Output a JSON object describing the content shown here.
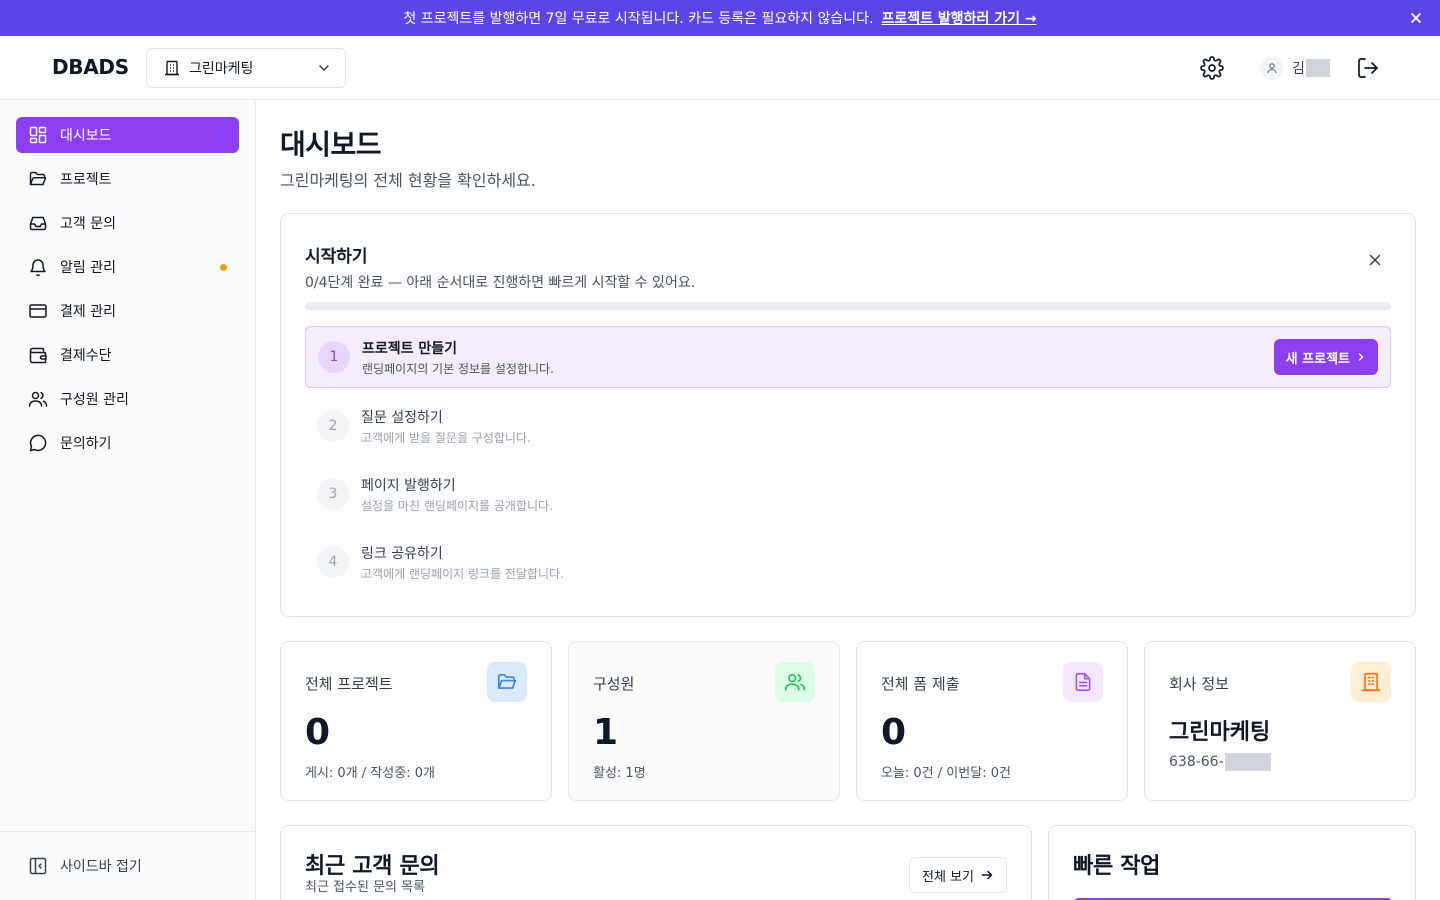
{
  "banner": {
    "text": "첫 프로젝트를 발행하면 7일 무료로 시작됩니다. 카드 등록은 필요하지 않습니다.",
    "link": "프로젝트 발행하러 가기 →",
    "bg_color": "#5b45e8"
  },
  "header": {
    "logo": "DBADS",
    "company_select": "그린마케팅",
    "user_name": "김"
  },
  "sidebar": {
    "items": [
      {
        "label": "대시보드",
        "icon": "dashboard-icon"
      },
      {
        "label": "프로젝트",
        "icon": "folder-icon"
      },
      {
        "label": "고객 문의",
        "icon": "inbox-icon"
      },
      {
        "label": "알림 관리",
        "icon": "bell-icon"
      },
      {
        "label": "결제 관리",
        "icon": "credit-card-icon"
      },
      {
        "label": "결제수단",
        "icon": "wallet-icon"
      },
      {
        "label": "구성원 관리",
        "icon": "users-icon"
      },
      {
        "label": "문의하기",
        "icon": "message-icon"
      }
    ],
    "collapse_label": "사이드바 접기",
    "accent_color": "#8b3ff0",
    "notification_dot_color": "#f59e0b"
  },
  "page": {
    "title": "대시보드",
    "subtitle": "그린마케팅의 전체 현황을 확인하세요."
  },
  "getting_started": {
    "title": "시작하기",
    "description": "0/4단계 완료 — 아래 순서대로 진행하면 빠르게 시작할 수 있어요.",
    "progress": 0,
    "steps": [
      {
        "num": "1",
        "title": "프로젝트 만들기",
        "desc": "랜딩페이지의 기본 정보를 설정합니다.",
        "button": "새 프로젝트"
      },
      {
        "num": "2",
        "title": "질문 설정하기",
        "desc": "고객에게 받을 질문을 구성합니다."
      },
      {
        "num": "3",
        "title": "페이지 발행하기",
        "desc": "설정을 마친 랜딩페이지를 공개합니다."
      },
      {
        "num": "4",
        "title": "링크 공유하기",
        "desc": "고객에게 랜딩페이지 링크를 전달합니다."
      }
    ]
  },
  "stats": {
    "projects": {
      "label": "전체 프로젝트",
      "value": "0",
      "sub": "게시: 0개 / 작성중: 0개",
      "icon": "folder-open-icon",
      "icon_color": "#3b82f6",
      "icon_bg": "#dbeafe"
    },
    "members": {
      "label": "구성원",
      "value": "1",
      "sub": "활성: 1명",
      "icon": "users-icon",
      "icon_color": "#22c55e",
      "icon_bg": "#dcfce7"
    },
    "forms": {
      "label": "전체 폼 제출",
      "value": "0",
      "sub": "오늘: 0건 / 이번달: 0건",
      "icon": "document-icon",
      "icon_color": "#a855f7",
      "icon_bg": "#f3e8ff"
    },
    "company": {
      "label": "회사 정보",
      "name": "그린마케팅",
      "biz_no": "638-66-",
      "icon": "building-icon",
      "icon_color": "#f97316",
      "icon_bg": "#ffedd5"
    }
  },
  "recent_inquiries": {
    "title": "최근 고객 문의",
    "subtitle": "최근 접수된 문의 목록",
    "view_all": "전체 보기"
  },
  "quick_actions": {
    "title": "빠른 작업"
  }
}
